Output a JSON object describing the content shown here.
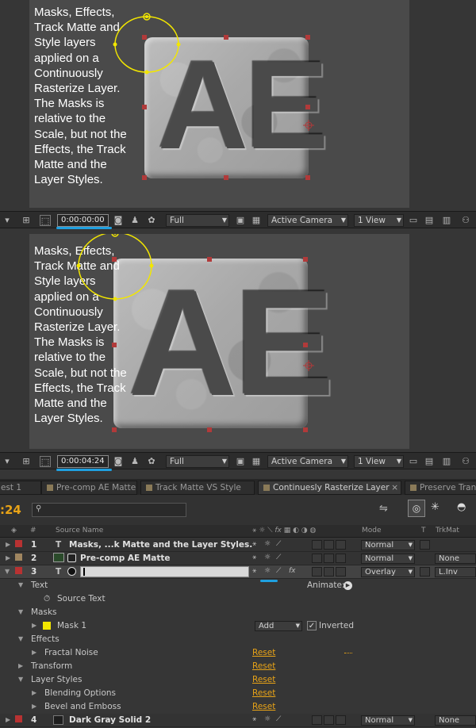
{
  "viewer": {
    "note": [
      "Masks, Effects,",
      "Track Matte and",
      "Style layers",
      "applied on a",
      "Continuously",
      "Rasterize Layer.",
      "The Masks is",
      "relative to the",
      "Scale, but not the",
      "Effects, the Track",
      "Matte and the",
      "Layer Styles."
    ],
    "artwork_text": "AE"
  },
  "toolbar_top": {
    "timecode": "0:00:00:00",
    "resolution": "Full",
    "camera": "Active Camera",
    "views": "1 View"
  },
  "toolbar_bottom": {
    "timecode": "0:00:04:24",
    "resolution": "Full",
    "camera": "Active Camera",
    "views": "1 View"
  },
  "tabs": [
    {
      "label": "est 1"
    },
    {
      "label": "Pre-comp AE Matte"
    },
    {
      "label": "Track Matte VS Style"
    },
    {
      "label": "Continuesly Rasterize Layer",
      "active": true
    },
    {
      "label": "Preserve Tran"
    }
  ],
  "timeline": {
    "current_time": ":24",
    "search_placeholder": "",
    "columns": {
      "number": "#",
      "source_name": "Source Name",
      "mode": "Mode",
      "t": "T",
      "trkmat": "TrkMat"
    },
    "animate_label": "Animate:"
  },
  "layers": [
    {
      "num": "1",
      "name": "Masks, ...k Matte and the Layer Styles.",
      "mode": "Normal",
      "trkmat": "",
      "color": "#b83232"
    },
    {
      "num": "2",
      "name": "Pre-comp AE Matte",
      "mode": "Normal",
      "trkmat": "None",
      "color": "#a08660"
    },
    {
      "num": "3",
      "name": "",
      "mode": "Overlay",
      "trkmat": "L.Inv",
      "color": "#b83232"
    },
    {
      "num": "4",
      "name": "Dark Gray Solid 2",
      "mode": "Normal",
      "trkmat": "None",
      "color": "#b83232"
    }
  ],
  "properties": {
    "text": "Text",
    "source_text": "Source Text",
    "masks": "Masks",
    "mask1": "Mask 1",
    "mask_mode": "Add",
    "inverted": "Inverted",
    "effects": "Effects",
    "fractal_noise": "Fractal Noise",
    "transform": "Transform",
    "layer_styles": "Layer Styles",
    "blending_options": "Blending Options",
    "bevel_emboss": "Bevel and Emboss",
    "reset": "Reset"
  },
  "colors": {
    "accent_orange": "#e8a317",
    "timecode_underline": "#1fa0e0",
    "mask_path": "#f2e600"
  }
}
